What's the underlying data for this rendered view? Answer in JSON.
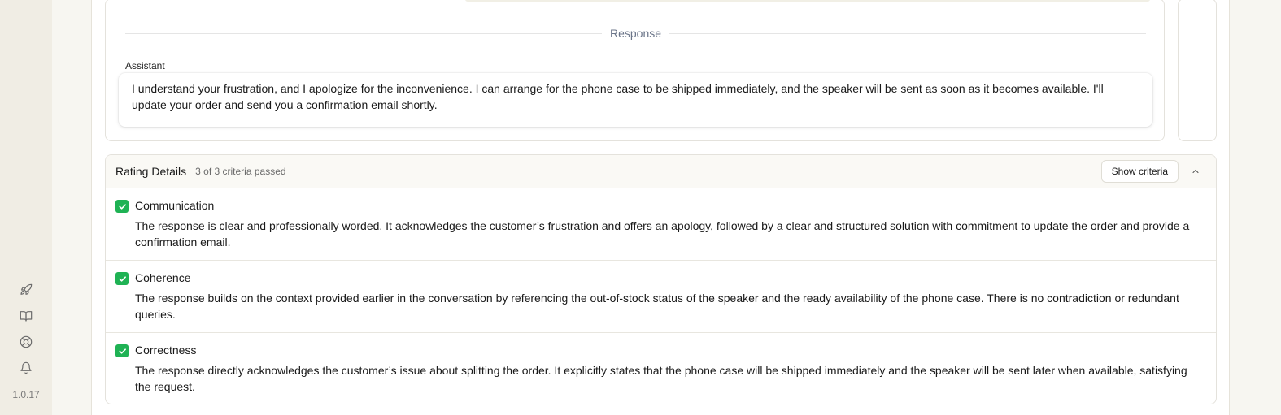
{
  "sidebar": {
    "icons": [
      "rocket-icon",
      "book-icon",
      "help-icon",
      "bell-icon"
    ],
    "version": "1.0.17"
  },
  "conversation": {
    "divider_label": "Response",
    "speaker": "Assistant",
    "response_text": "I understand your frustration, and I apologize for the inconvenience. I can arrange for the phone case to be shipped immediately, and the speaker will be sent as soon as it becomes available. I'll update your order and send you a confirmation email shortly."
  },
  "rating": {
    "title": "Rating Details",
    "summary": "3 of 3 criteria passed",
    "show_criteria_label": "Show criteria",
    "criteria": [
      {
        "name": "Communication",
        "passed": true,
        "description": "The response is clear and professionally worded. It acknowledges the customer’s frustration and offers an apology, followed by a clear and structured solution with commitment to update the order and provide a confirmation email."
      },
      {
        "name": "Coherence",
        "passed": true,
        "description": "The response builds on the context provided earlier in the conversation by referencing the out-of-stock status of the speaker and the ready availability of the phone case. There is no contradiction or redundant queries."
      },
      {
        "name": "Correctness",
        "passed": true,
        "description": "The response directly acknowledges the customer’s issue about splitting the order. It explicitly states that the phone case will be shipped immediately and the speaker will be sent later when available, satisfying the request."
      }
    ]
  },
  "colors": {
    "check_green": "#1fb254",
    "divider_text": "#6b7589",
    "app_background": "#f0ede4"
  }
}
